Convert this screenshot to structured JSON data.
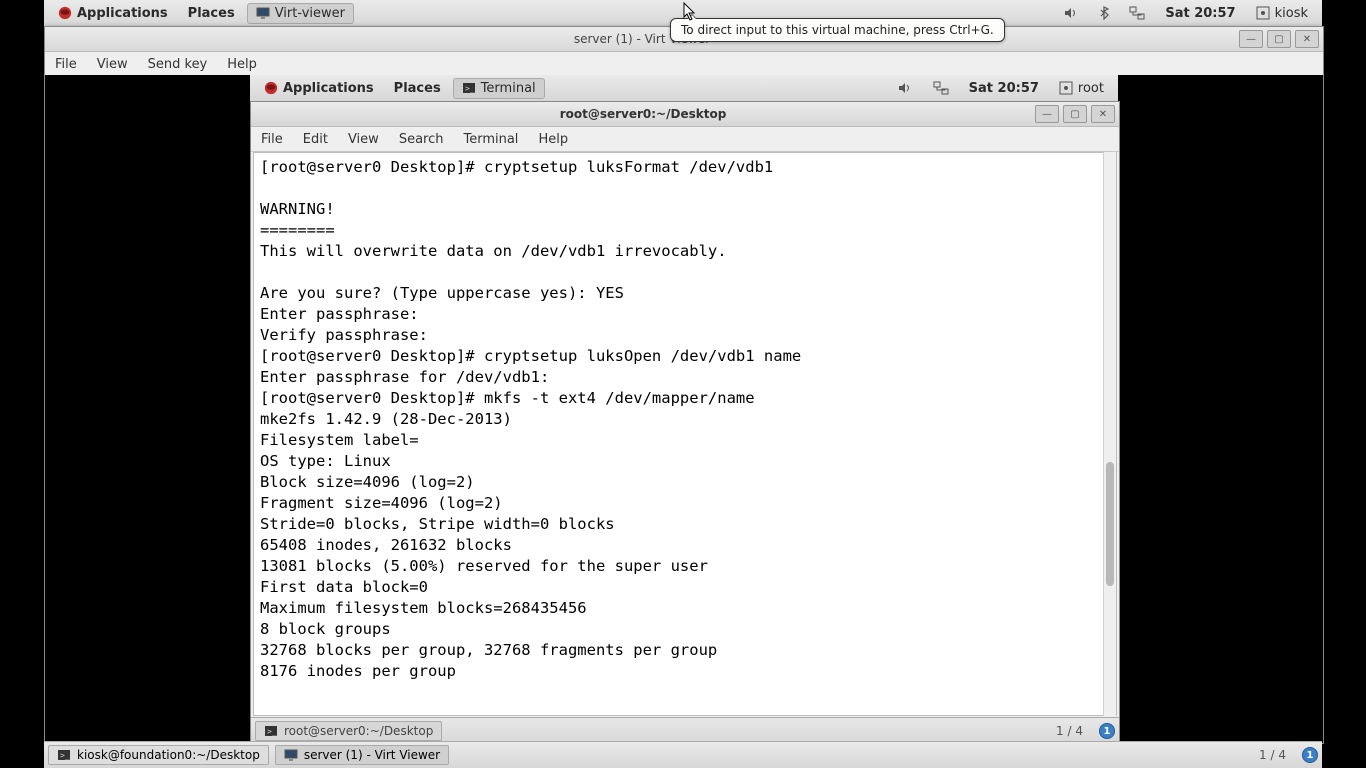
{
  "host_panel": {
    "applications": "Applications",
    "places": "Places",
    "task": "Virt-viewer",
    "clock": "Sat 20:57",
    "user": "kiosk"
  },
  "tooltip_text": "To direct input to this virtual machine, press Ctrl+G.",
  "virt": {
    "title": "server (1) - Virt Viewer",
    "menu": [
      "File",
      "View",
      "Send key",
      "Help"
    ]
  },
  "guest_panel": {
    "applications": "Applications",
    "places": "Places",
    "task": "Terminal",
    "clock": "Sat 20:57",
    "user": "root"
  },
  "terminal": {
    "title": "root@server0:~/Desktop",
    "menu": [
      "File",
      "Edit",
      "View",
      "Search",
      "Terminal",
      "Help"
    ],
    "content": "[root@server0 Desktop]# cryptsetup luksFormat /dev/vdb1\n\nWARNING!\n========\nThis will overwrite data on /dev/vdb1 irrevocably.\n\nAre you sure? (Type uppercase yes): YES\nEnter passphrase: \nVerify passphrase: \n[root@server0 Desktop]# cryptsetup luksOpen /dev/vdb1 name\nEnter passphrase for /dev/vdb1: \n[root@server0 Desktop]# mkfs -t ext4 /dev/mapper/name\nmke2fs 1.42.9 (28-Dec-2013)\nFilesystem label=\nOS type: Linux\nBlock size=4096 (log=2)\nFragment size=4096 (log=2)\nStride=0 blocks, Stripe width=0 blocks\n65408 inodes, 261632 blocks\n13081 blocks (5.00%) reserved for the super user\nFirst data block=0\nMaximum filesystem blocks=268435456\n8 block groups\n32768 blocks per group, 32768 fragments per group\n8176 inodes per group"
  },
  "guest_bottom": {
    "task": "root@server0:~/Desktop",
    "workspace": "1 / 4",
    "badge": "1"
  },
  "host_bottom": {
    "task1": "kiosk@foundation0:~/Desktop",
    "task2": "server (1) - Virt Viewer",
    "workspace": "1 / 4",
    "badge": "1"
  }
}
